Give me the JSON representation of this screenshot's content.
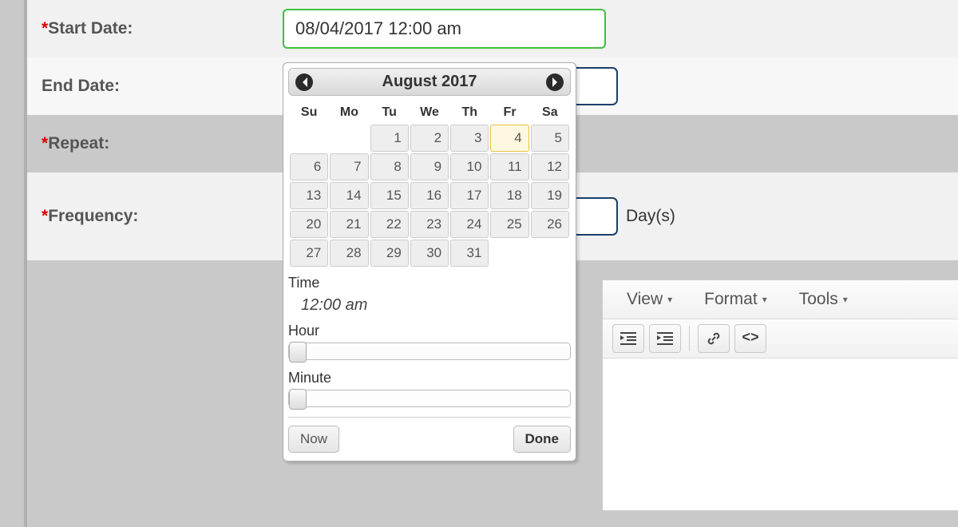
{
  "form": {
    "start_date": {
      "label": "Start Date:",
      "value": "08/04/2017 12:00 am",
      "required": true
    },
    "end_date": {
      "label": "End Date:",
      "required": false
    },
    "repeat": {
      "label": "Repeat:",
      "required": true
    },
    "frequency": {
      "label": "Frequency:",
      "required": true,
      "unit": "Day(s)"
    }
  },
  "datepicker": {
    "title": "August 2017",
    "dow": [
      "Su",
      "Mo",
      "Tu",
      "We",
      "Th",
      "Fr",
      "Sa"
    ],
    "weeks": [
      [
        null,
        null,
        1,
        2,
        3,
        4,
        5
      ],
      [
        6,
        7,
        8,
        9,
        10,
        11,
        12
      ],
      [
        13,
        14,
        15,
        16,
        17,
        18,
        19
      ],
      [
        20,
        21,
        22,
        23,
        24,
        25,
        26
      ],
      [
        27,
        28,
        29,
        30,
        31,
        null,
        null
      ]
    ],
    "today": 4,
    "time_label": "Time",
    "time_value": "12:00 am",
    "hour_label": "Hour",
    "minute_label": "Minute",
    "now_label": "Now",
    "done_label": "Done"
  },
  "editor": {
    "menus": {
      "view": "View",
      "format": "Format",
      "tools": "Tools"
    },
    "icons": {
      "outdent": "outdent-icon",
      "indent": "indent-icon",
      "link": "link-icon",
      "code": "source-code-icon"
    }
  }
}
